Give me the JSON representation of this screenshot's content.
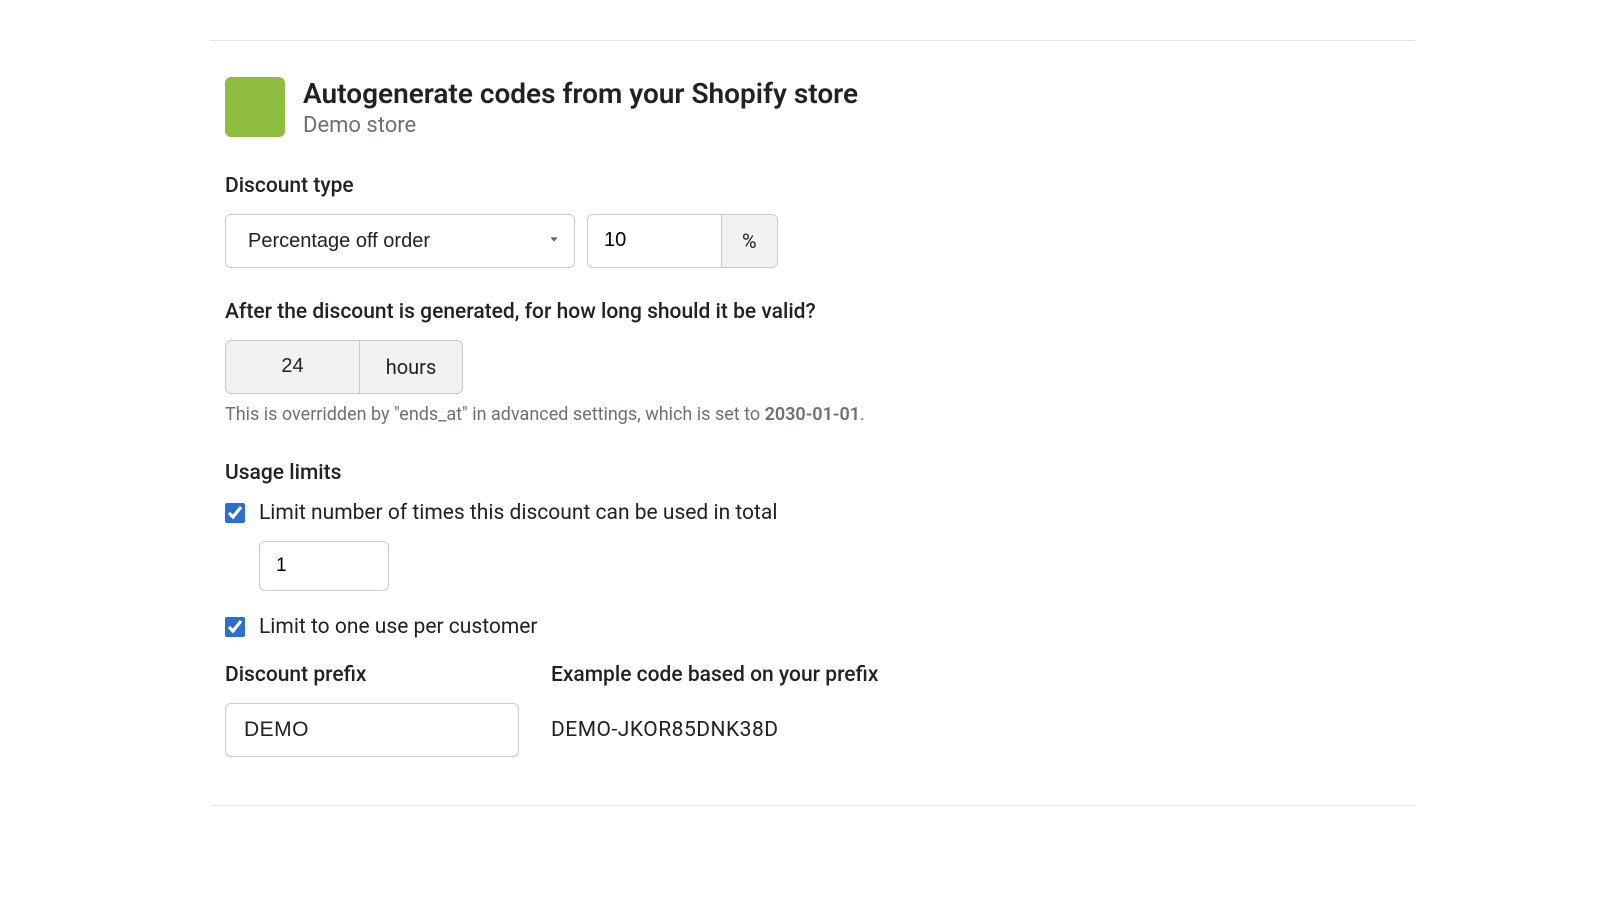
{
  "header": {
    "title": "Autogenerate codes from your Shopify store",
    "store_name": "Demo store"
  },
  "discount_type": {
    "label": "Discount type",
    "selected": "Percentage off order",
    "value": "10",
    "unit": "%"
  },
  "validity": {
    "label": "After the discount is generated, for how long should it be valid?",
    "value": "24",
    "unit": "hours",
    "help_prefix": "This is overridden by \"ends_at\" in advanced settings, which is set to ",
    "help_date": "2030-01-01",
    "help_suffix": "."
  },
  "usage_limits": {
    "label": "Usage limits",
    "limit_total_label": "Limit number of times this discount can be used in total",
    "limit_total_value": "1",
    "limit_per_customer_label": "Limit to one use per customer"
  },
  "prefix": {
    "label": "Discount prefix",
    "value": "DEMO",
    "example_label": "Example code based on your prefix",
    "example_value": "DEMO-JKOR85DNK38D"
  }
}
